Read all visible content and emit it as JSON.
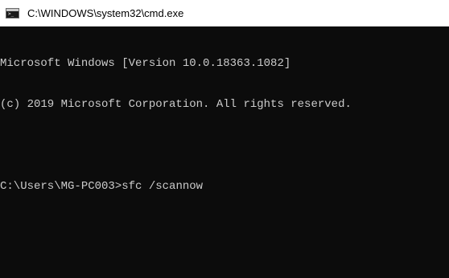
{
  "window": {
    "title": "C:\\WINDOWS\\system32\\cmd.exe",
    "icon": "cmd-console-icon",
    "icon_text": ">_"
  },
  "console": {
    "lines": [
      "Microsoft Windows [Version 10.0.18363.1082]",
      "(c) 2019 Microsoft Corporation. All rights reserved.",
      "",
      "C:\\Users\\MG-PC003>sfc /scannow"
    ],
    "prompt": "C:\\Users\\MG-PC003>",
    "command": "sfc /scannow"
  },
  "colors": {
    "console_background": "#0c0c0c",
    "console_text": "#cccccc",
    "titlebar_background": "#ffffff"
  }
}
